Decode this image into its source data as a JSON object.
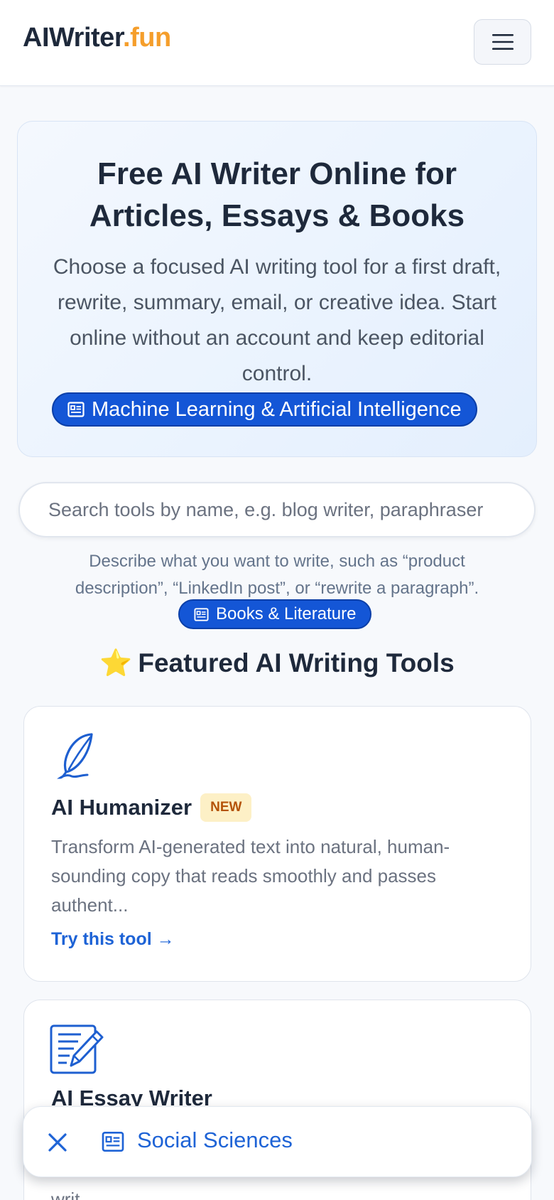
{
  "header": {
    "logo_main": "AIWriter",
    "logo_accent": ".fun",
    "menu_icon": "hamburger-menu-icon"
  },
  "hero": {
    "title": "Free AI Writer Online for Articles, Essays & Books",
    "description": "Choose a focused AI writing tool for a first draft, rewrite, summary, email, or creative idea. Start online without an account and keep editorial control.",
    "category_pill": "Machine Learning & Artificial Intelligence"
  },
  "search": {
    "placeholder": "Search tools by name, e.g. blog writer, paraphraser",
    "hint": "Describe what you want to write, such as “product description”, “LinkedIn post”, or “rewrite a paragraph”.",
    "category_pill": "Books & Literature"
  },
  "featured": {
    "star": "⭐",
    "title": "Featured AI Writing Tools",
    "cards": [
      {
        "icon": "quill-pen-icon",
        "title": "AI Humanizer",
        "badge": "NEW",
        "description": "Transform AI-generated text into natural, human-sounding copy that reads smoothly and passes authent...",
        "link": "Try this tool →"
      },
      {
        "icon": "document-edit-icon",
        "title": "AI Essay Writer",
        "description": "writ"
      }
    ]
  },
  "toast": {
    "close_icon": "close-icon",
    "category_icon": "newspaper-icon",
    "label": "Social Sciences"
  },
  "colors": {
    "brand_accent": "#f59e2b",
    "primary_blue": "#1456d6",
    "link_blue": "#1e63d6",
    "badge_bg": "#fdf0c6",
    "badge_text": "#b45309"
  }
}
